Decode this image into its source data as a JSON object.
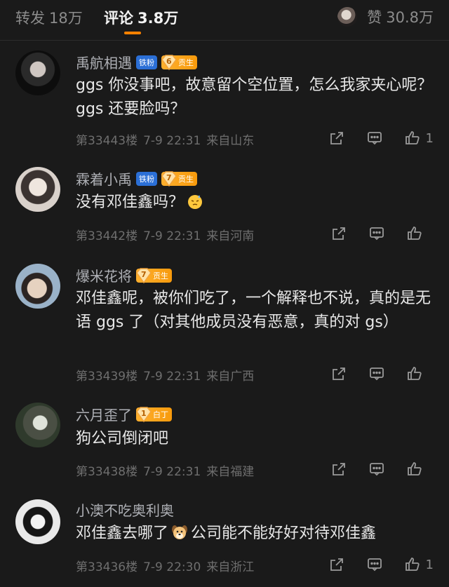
{
  "tabs": {
    "repost": {
      "label": "转发",
      "count": "18万"
    },
    "comment": {
      "label": "评论",
      "count": "3.8万"
    },
    "like": {
      "label": "赞",
      "count": "30.8万"
    }
  },
  "comments": [
    {
      "name": "禹航相遇",
      "fan_badge": "铁粉",
      "level": "6",
      "level_label": "贡生",
      "text": "ggs 你没事吧，故意留个空位置，怎么我家夹心呢？ggs 还要脸吗？",
      "floor": "第33443楼",
      "time": "7-9 22:31",
      "location": "来自山东",
      "likes": "1"
    },
    {
      "name": "霖着小禹",
      "fan_badge": "铁粉",
      "level": "7",
      "level_label": "贡生",
      "text": "没有邓佳鑫吗？",
      "floor": "第33442楼",
      "time": "7-9 22:31",
      "location": "来自河南",
      "likes": ""
    },
    {
      "name": "爆米花将",
      "fan_badge": "",
      "level": "7",
      "level_label": "贡生",
      "text": "邓佳鑫呢，被你们吃了，一个解释也不说，真的是无语 ggs 了（对其他成员没有恶意，真的对 gs）",
      "floor": "第33439楼",
      "time": "7-9 22:31",
      "location": "来自广西",
      "likes": ""
    },
    {
      "name": "六月歪了",
      "fan_badge": "",
      "level": "1",
      "level_label": "白丁",
      "text": "狗公司倒闭吧",
      "floor": "第33438楼",
      "time": "7-9 22:31",
      "location": "来自福建",
      "likes": ""
    },
    {
      "name": "小澳不吃奥利奥",
      "fan_badge": "",
      "level": "",
      "level_label": "",
      "text_before": "邓佳鑫去哪了",
      "text_after": "公司能不能好好对待邓佳鑫",
      "floor": "第33436楼",
      "time": "7-9 22:30",
      "location": "来自浙江",
      "likes": "1"
    }
  ],
  "icons": {
    "share": "share-icon",
    "comment": "comment-icon",
    "like": "thumbs-up-icon",
    "emoji_sweat": "sweat-emoji-icon",
    "emoji_dog": "dog-emoji-icon"
  },
  "colors": {
    "accent": "#ff8200",
    "fan_badge": "#2b6fd6",
    "level_badge": "#f79a0c",
    "background": "#1a1a1a"
  }
}
